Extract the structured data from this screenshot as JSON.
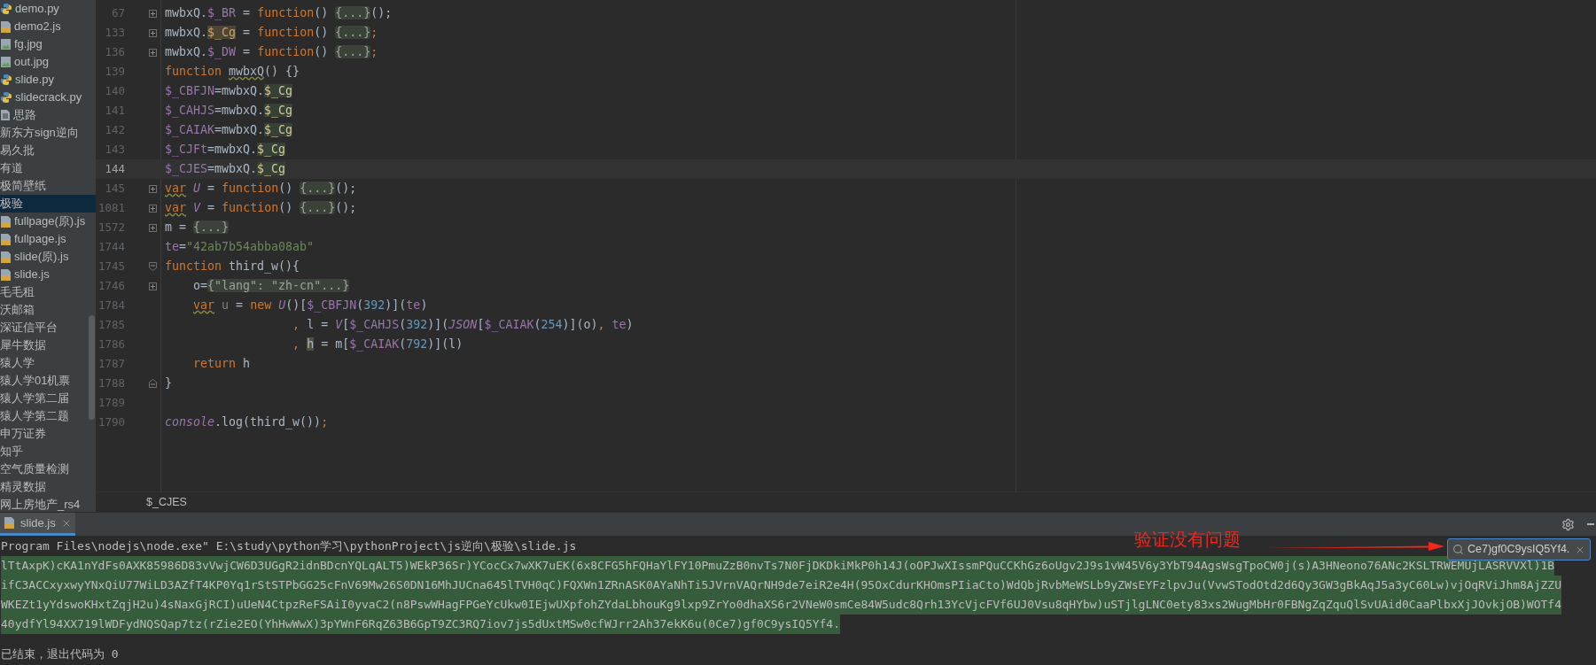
{
  "project_tree": {
    "items": [
      {
        "label": "demo.py",
        "kind": "py",
        "selected": false
      },
      {
        "label": "demo2.js",
        "kind": "js",
        "selected": false
      },
      {
        "label": "fg.jpg",
        "kind": "image",
        "selected": false
      },
      {
        "label": "out.jpg",
        "kind": "image",
        "selected": false
      },
      {
        "label": "slide.py",
        "kind": "py",
        "selected": false
      },
      {
        "label": "slidecrack.py",
        "kind": "py",
        "selected": false
      },
      {
        "label": "思路",
        "kind": "text",
        "selected": false
      },
      {
        "label": "新东方sign逆向",
        "kind": "folder",
        "selected": false
      },
      {
        "label": "易久批",
        "kind": "folder",
        "selected": false
      },
      {
        "label": "有道",
        "kind": "folder",
        "selected": false
      },
      {
        "label": "极简壁纸",
        "kind": "folder",
        "selected": false
      },
      {
        "label": "极验",
        "kind": "folder",
        "selected": true,
        "children": [
          {
            "label": "fullpage(原).js",
            "kind": "js",
            "selected": false
          },
          {
            "label": "fullpage.js",
            "kind": "js",
            "selected": false
          },
          {
            "label": "slide(原).js",
            "kind": "js",
            "selected": false
          },
          {
            "label": "slide.js",
            "kind": "js",
            "selected": false
          }
        ]
      },
      {
        "label": "毛毛租",
        "kind": "folder",
        "selected": false
      },
      {
        "label": "沃邮箱",
        "kind": "folder",
        "selected": false
      },
      {
        "label": "深证信平台",
        "kind": "folder",
        "selected": false
      },
      {
        "label": "犀牛数据",
        "kind": "folder",
        "selected": false
      },
      {
        "label": "猿人学",
        "kind": "folder",
        "selected": false
      },
      {
        "label": "猿人学01机票",
        "kind": "folder",
        "selected": false
      },
      {
        "label": "猿人学第二届",
        "kind": "folder",
        "selected": false
      },
      {
        "label": "猿人学第二题",
        "kind": "folder",
        "selected": false
      },
      {
        "label": "申万证券",
        "kind": "folder",
        "selected": false
      },
      {
        "label": "知乎",
        "kind": "folder",
        "selected": false
      },
      {
        "label": "空气质量检测",
        "kind": "folder",
        "selected": false
      },
      {
        "label": "精灵数据",
        "kind": "folder",
        "selected": false
      },
      {
        "label": "网上房地产_rs4",
        "kind": "folder",
        "selected": false
      }
    ]
  },
  "editor": {
    "lines": [
      {
        "number": "67",
        "kind": "folded",
        "current": false,
        "tokens": [
          {
            "kind": "plain",
            "text": "mwbxQ."
          },
          {
            "kind": "purple",
            "text": "$_BR"
          },
          {
            "kind": "plain",
            "text": " = "
          },
          {
            "kind": "kw",
            "text": "function"
          },
          {
            "kind": "plain",
            "text": "() "
          },
          {
            "kind": "fold",
            "text": "{...}"
          },
          {
            "kind": "plain",
            "text": "();"
          }
        ]
      },
      {
        "number": "133",
        "kind": "folded",
        "current": false,
        "tokens": [
          {
            "kind": "plain",
            "text": "mwbxQ."
          },
          {
            "kind": "write",
            "text": "$_Cg"
          },
          {
            "kind": "plain",
            "text": " = "
          },
          {
            "kind": "kw",
            "text": "function"
          },
          {
            "kind": "plain",
            "text": "() "
          },
          {
            "kind": "fold",
            "text": "{...}"
          },
          {
            "kind": "kw",
            "text": ";"
          }
        ]
      },
      {
        "number": "136",
        "kind": "folded",
        "current": false,
        "tokens": [
          {
            "kind": "plain",
            "text": "mwbxQ."
          },
          {
            "kind": "purple",
            "text": "$_DW"
          },
          {
            "kind": "plain",
            "text": " = "
          },
          {
            "kind": "kw",
            "text": "function"
          },
          {
            "kind": "plain",
            "text": "() "
          },
          {
            "kind": "fold",
            "text": "{...}"
          },
          {
            "kind": "kw",
            "text": ";"
          }
        ]
      },
      {
        "number": "139",
        "kind": "code",
        "current": false,
        "tokens": [
          {
            "kind": "kw",
            "text": "function "
          },
          {
            "kind": "warn",
            "text": "mwbxQ"
          },
          {
            "kind": "plain",
            "text": "() {}"
          }
        ]
      },
      {
        "number": "140",
        "kind": "code",
        "current": false,
        "tokens": [
          {
            "kind": "purple",
            "text": "$_CBFJN"
          },
          {
            "kind": "plain",
            "text": "=mwbxQ."
          },
          {
            "kind": "usage",
            "text": "$_Cg"
          }
        ]
      },
      {
        "number": "141",
        "kind": "code",
        "current": false,
        "tokens": [
          {
            "kind": "purple",
            "text": "$_CAHJS"
          },
          {
            "kind": "plain",
            "text": "=mwbxQ."
          },
          {
            "kind": "usage",
            "text": "$_Cg"
          }
        ]
      },
      {
        "number": "142",
        "kind": "code",
        "current": false,
        "tokens": [
          {
            "kind": "purple",
            "text": "$_CAIAK"
          },
          {
            "kind": "plain",
            "text": "=mwbxQ."
          },
          {
            "kind": "usage",
            "text": "$_Cg"
          }
        ]
      },
      {
        "number": "143",
        "kind": "code",
        "current": false,
        "tokens": [
          {
            "kind": "purple",
            "text": "$_CJFt"
          },
          {
            "kind": "plain",
            "text": "=mwbxQ."
          },
          {
            "kind": "usage",
            "text": "$_Cg"
          }
        ]
      },
      {
        "number": "144",
        "kind": "code",
        "current": true,
        "tokens": [
          {
            "kind": "purple",
            "text": "$_CJES"
          },
          {
            "kind": "plain",
            "text": "=mwbxQ."
          },
          {
            "kind": "usage",
            "text": "$_Cg"
          }
        ]
      },
      {
        "number": "145",
        "kind": "folded",
        "current": false,
        "tokens": [
          {
            "kind": "kw-warn",
            "text": "var"
          },
          {
            "kind": "ipurple",
            "text": " U"
          },
          {
            "kind": "plain",
            "text": " = "
          },
          {
            "kind": "kw",
            "text": "function"
          },
          {
            "kind": "plain",
            "text": "() "
          },
          {
            "kind": "fold",
            "text": "{...}"
          },
          {
            "kind": "plain",
            "text": "();"
          }
        ]
      },
      {
        "number": "1081",
        "kind": "folded",
        "current": false,
        "tokens": [
          {
            "kind": "kw-warn",
            "text": "var"
          },
          {
            "kind": "ipurple",
            "text": " V"
          },
          {
            "kind": "plain",
            "text": " = "
          },
          {
            "kind": "kw",
            "text": "function"
          },
          {
            "kind": "plain",
            "text": "() "
          },
          {
            "kind": "fold",
            "text": "{...}"
          },
          {
            "kind": "plain",
            "text": "();"
          }
        ]
      },
      {
        "number": "1572",
        "kind": "folded",
        "current": false,
        "tokens": [
          {
            "kind": "plain",
            "text": "m = "
          },
          {
            "kind": "fold",
            "text": "{...}"
          }
        ]
      },
      {
        "number": "1744",
        "kind": "code",
        "current": false,
        "tokens": [
          {
            "kind": "purple",
            "text": "te"
          },
          {
            "kind": "plain",
            "text": "="
          },
          {
            "kind": "str",
            "text": "\"42ab7b54abba08ab\""
          }
        ]
      },
      {
        "number": "1745",
        "kind": "block-start",
        "current": false,
        "tokens": [
          {
            "kind": "kw",
            "text": "function "
          },
          {
            "kind": "plain",
            "text": "third_w(){"
          }
        ]
      },
      {
        "number": "1746",
        "kind": "folded",
        "current": false,
        "tokens": [
          {
            "kind": "plain",
            "text": "    o="
          },
          {
            "kind": "fold",
            "text": "{\"lang\": \"zh-cn\"...}"
          }
        ]
      },
      {
        "number": "1784",
        "kind": "code",
        "current": false,
        "tokens": [
          {
            "kind": "kw-warn",
            "text": "    var"
          },
          {
            "kind": "dim",
            "text": " u"
          },
          {
            "kind": "plain",
            "text": " = "
          },
          {
            "kind": "kw",
            "text": "new "
          },
          {
            "kind": "ipurple",
            "text": "U"
          },
          {
            "kind": "plain",
            "text": "()["
          },
          {
            "kind": "purple",
            "text": "$_CBFJN"
          },
          {
            "kind": "plain",
            "text": "("
          },
          {
            "kind": "num",
            "text": "392"
          },
          {
            "kind": "plain",
            "text": ")]("
          },
          {
            "kind": "purple",
            "text": "te"
          },
          {
            "kind": "plain",
            "text": ")"
          }
        ]
      },
      {
        "number": "1785",
        "kind": "code",
        "current": false,
        "tokens": [
          {
            "kind": "kw",
            "text": "                  , "
          },
          {
            "kind": "plain",
            "text": "l = "
          },
          {
            "kind": "ipurple",
            "text": "V"
          },
          {
            "kind": "plain",
            "text": "["
          },
          {
            "kind": "purple",
            "text": "$_CAHJS"
          },
          {
            "kind": "plain",
            "text": "("
          },
          {
            "kind": "num",
            "text": "392"
          },
          {
            "kind": "plain",
            "text": ")]("
          },
          {
            "kind": "ipurple",
            "text": "JSON"
          },
          {
            "kind": "plain",
            "text": "["
          },
          {
            "kind": "purple",
            "text": "$_CAIAK"
          },
          {
            "kind": "plain",
            "text": "("
          },
          {
            "kind": "num",
            "text": "254"
          },
          {
            "kind": "plain",
            "text": ")](o)"
          },
          {
            "kind": "kw",
            "text": ", "
          },
          {
            "kind": "purple",
            "text": "te"
          },
          {
            "kind": "plain",
            "text": ")"
          }
        ]
      },
      {
        "number": "1786",
        "kind": "code",
        "current": false,
        "tokens": [
          {
            "kind": "kw",
            "text": "                  , "
          },
          {
            "kind": "mark",
            "text": "h"
          },
          {
            "kind": "plain",
            "text": " = m["
          },
          {
            "kind": "purple",
            "text": "$_CAIAK"
          },
          {
            "kind": "plain",
            "text": "("
          },
          {
            "kind": "num",
            "text": "792"
          },
          {
            "kind": "plain",
            "text": ")](l)"
          }
        ]
      },
      {
        "number": "1787",
        "kind": "code",
        "current": false,
        "tokens": [
          {
            "kind": "kw",
            "text": "    return "
          },
          {
            "kind": "plain",
            "text": "h"
          }
        ]
      },
      {
        "number": "1788",
        "kind": "block-end",
        "current": false,
        "tokens": [
          {
            "kind": "plain",
            "text": "}"
          }
        ]
      },
      {
        "number": "1789",
        "kind": "code",
        "current": false
      },
      {
        "number": "1790",
        "kind": "code",
        "current": false,
        "tokens": [
          {
            "kind": "ipurple",
            "text": "console"
          },
          {
            "kind": "plain",
            "text": ".log(third_w())"
          },
          {
            "kind": "kw",
            "text": ";"
          }
        ]
      }
    ],
    "breadcrumb": "$_CJES"
  },
  "run_panel": {
    "tab": {
      "label": "slide.js",
      "selected": true
    },
    "command": "Program Files\\nodejs\\node.exe\" E:\\study\\python学习\\pythonProject\\js逆向\\极验\\slide.js",
    "output_lines": [
      {
        "text": "lTtAxpK)cKA1nYdFs0AXK85986D83vVwjCW6D3UGgR2idnBDcnYQLqALT5)WEkP36Sr)YCocCx7wXK7uEK(6x8CFG5hFQHaYlFY10PmuZzB0nvTs7N0FjDKDkiMkP0h14J(oOPJwXIssmPQuCCKhGz6oUgv2J9s1vW45V6y3YbT94AgsWsgTpoCW0j(s)A3HNeono76ANc2KSLTRWEMUjLASRVVXl)1B",
        "highlighted": true
      },
      {
        "text": "ifC3ACCxyxwyYNxQiU77WiLD3AZfT4KP0Yq1rStSTPbGG25cFnV69Mw26S0DN16MhJUCna645lTVH0qC)FQXWn1ZRnASK0AYaNhTi5JVrnVAQrNH9de7eiR2e4H(95OxCdurKHOmsPIiaCto)WdQbjRvbMeWSLb9yZWsEYFzlpvJu(VvwSTodOtd2d6Qy3GW3gBkAqJ5a3yC60Lw)vjOqRViJhm8AjZZU",
        "highlighted": true
      },
      {
        "text": "WKEZt1yYdswoKHxtZqjH2u)4sNaxGjRCI)uUeN4CtpzReFSAiI0yvaC2(n8PswWHagFPGeYcUkw0IEjwUXpfohZYdaLbhouKg9lxp9ZrYo0dhaXS6r2VNeW0smCe84W5udc8Qrh13YcVjcFVf6UJ0Vsu8qHYbw)uSTjlgLNC0ety83xs2WugMbHr0FBNgZqZquQlSvUAid0CaaPlbxXjJOvkjOB)WOTf4",
        "highlighted": true
      },
      {
        "text": "40ydfYl94XX719lWDFydNQSQap7tz(rZie2EO(YhHwWwX)3pYWnF6RqZ63B6GpT9ZC3RQ7iov7js5dUxtMSw0cfWJrr2Ah37ekK6u(0Ce7)gf0C9ysIQ5Yf4.",
        "highlighted": true
      }
    ],
    "exit_message": "已结束，退出代码为 0",
    "search": {
      "value": "Ce7)gf0C9ysIQ5Yf4."
    }
  },
  "annotation": {
    "text": "验证没有问题"
  }
}
